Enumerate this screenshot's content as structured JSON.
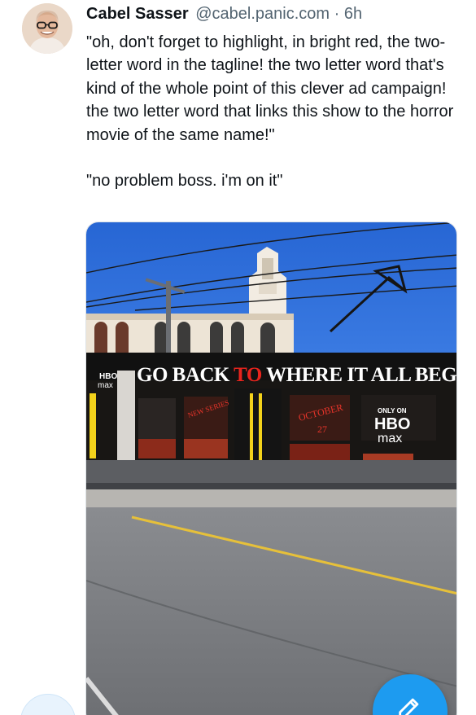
{
  "tweet": {
    "author_name": "Cabel Sasser",
    "author_handle": "@cabel.panic.com",
    "separator": "·",
    "timestamp": "6h",
    "text_paragraphs": [
      "\"oh, don't forget to highlight, in bright red, the two-letter word in the tagline! the two letter word that's kind of the whole point of this clever ad campaign! the two letter word that links this show to the horror movie of the same name!\"",
      "\"no problem boss. i'm on it\""
    ]
  },
  "media": {
    "tagline": {
      "before": "GO BACK ",
      "highlight": "TO",
      "after": " WHERE IT ALL BEGAN"
    },
    "logo_side": {
      "top": "HBO",
      "bottom": "max"
    },
    "logo_right": {
      "prefix": "ONLY ON",
      "top": "HBO",
      "bottom": "max"
    },
    "panel_new_series": "NEW SERIES",
    "panel_date_line1": "OCTOBER",
    "panel_date_line2": "27",
    "colors": {
      "tagline": "#ffffff",
      "highlight": "#e8241d",
      "tram_body": "#181614",
      "tram_doors": "#f3d21b",
      "sky": "#2f6fd8"
    }
  },
  "icons": {
    "compose": "compose-pen-icon"
  }
}
